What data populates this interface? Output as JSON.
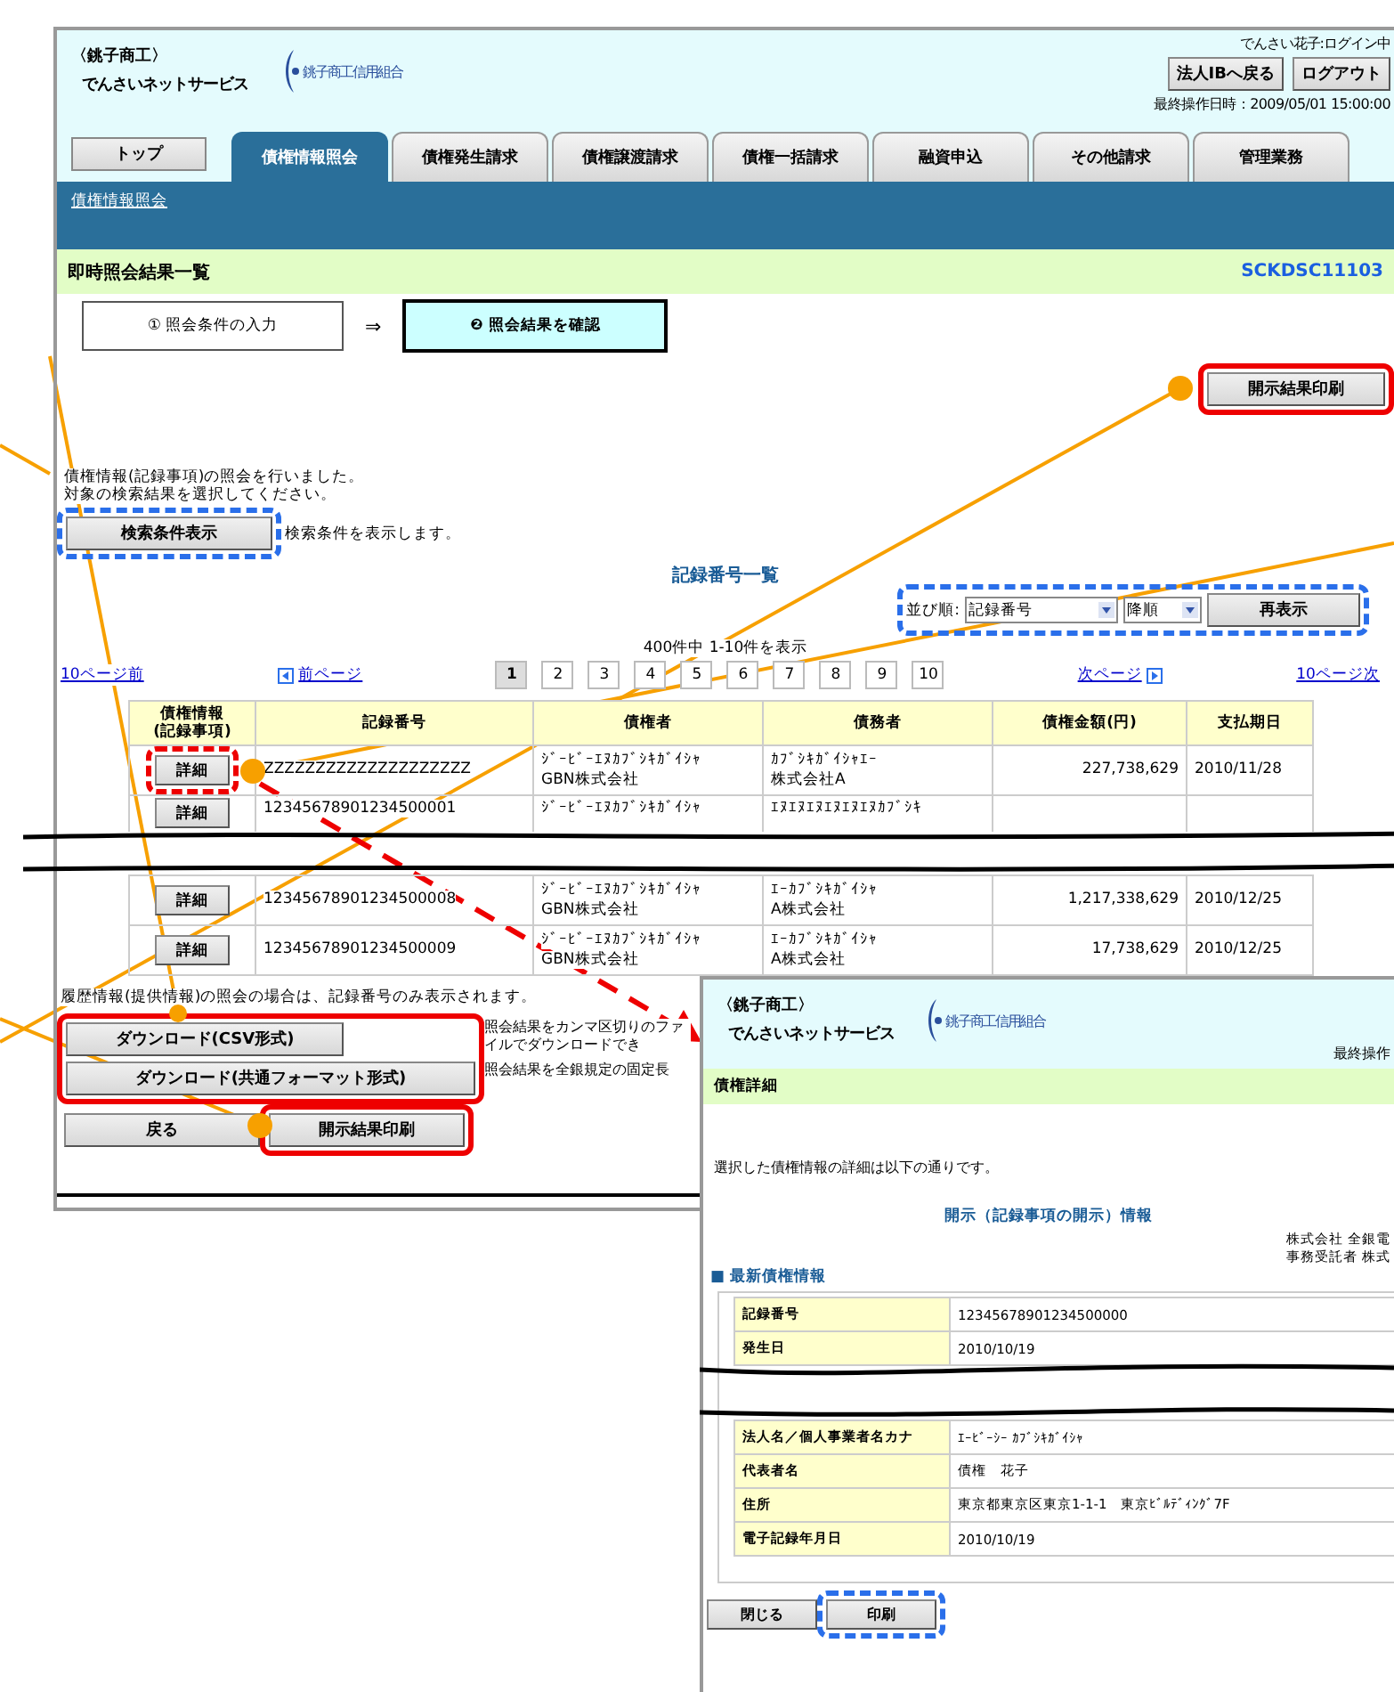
{
  "main_window": {
    "brand": {
      "line1": "〈銚子商工〉",
      "line2": "でんさいネットサービス",
      "logo_text": "銚子商工信用組合"
    },
    "user_status": "でんさい花子:ログイン中",
    "header_buttons": [
      "法人IBへ戻る",
      "ログアウト"
    ],
    "last_operation": "最終操作日時：2009/05/01 15:00:00",
    "tabs": [
      {
        "label": "トップ",
        "kind": "plain",
        "selected": false
      },
      {
        "label": "債権情報照会",
        "kind": "tab",
        "selected": true
      },
      {
        "label": "債権発生請求",
        "kind": "tab",
        "selected": false
      },
      {
        "label": "債権譲渡請求",
        "kind": "tab",
        "selected": false
      },
      {
        "label": "債権一括請求",
        "kind": "tab",
        "selected": false
      },
      {
        "label": "融資申込",
        "kind": "tab",
        "selected": false
      },
      {
        "label": "その他請求",
        "kind": "tab",
        "selected": false
      },
      {
        "label": "管理業務",
        "kind": "tab",
        "selected": false
      }
    ],
    "breadcrumb": "債権情報照会",
    "page_title": "即時照会結果一覧",
    "screen_id": "SCKDSC11103",
    "steps": [
      {
        "label": "① 照会条件の入力",
        "selected": false
      },
      {
        "label": "❷ 照会結果を確認",
        "selected": true
      }
    ],
    "step_arrow": "⇒",
    "top_print_button": {
      "label": "開示結果印刷",
      "highlight": {
        "kind": "red_solid"
      }
    },
    "message": [
      "債権情報(記録事項)の照会を行いました。",
      "対象の検索結果を選択してください。"
    ],
    "search_condition": {
      "button": "検索条件表示",
      "highlight": {
        "kind": "blue_dashed"
      },
      "hint": "検索条件を表示します。"
    },
    "list_title": "記録番号一覧",
    "sort": {
      "label": "並び順:",
      "field": "記録番号",
      "order": "降順",
      "button": "再表示",
      "highlight": {
        "kind": "blue_dashed"
      }
    },
    "result_count": "400件中 1-10件を表示",
    "pagination": {
      "prev10": "10ページ前",
      "prev": "前ページ",
      "pages": [
        {
          "label": "1",
          "selected": true
        },
        {
          "label": "2",
          "selected": false
        },
        {
          "label": "3",
          "selected": false
        },
        {
          "label": "4",
          "selected": false
        },
        {
          "label": "5",
          "selected": false
        },
        {
          "label": "6",
          "selected": false
        },
        {
          "label": "7",
          "selected": false
        },
        {
          "label": "8",
          "selected": false
        },
        {
          "label": "9",
          "selected": false
        },
        {
          "label": "10",
          "selected": false
        }
      ],
      "next": "次ページ",
      "next10": "10ページ次"
    },
    "table": {
      "columns": [
        "債権情報\n(記録事項)",
        "記録番号",
        "債権者",
        "債務者",
        "債権金額(円)",
        "支払期日"
      ],
      "rows": [
        {
          "kind": "row",
          "button": "詳細",
          "highlight": {
            "kind": "red_dashed"
          },
          "record_no": "ZZZZZZZZZZZZZZZZZZZZ",
          "creditor": [
            "ｼﾞｰﾋﾞｰｴﾇｶﾌﾞｼｷｶﾞｲｼｬ",
            "GBN株式会社"
          ],
          "debtor": [
            "ｶﾌﾞｼｷｶﾞｲｼｬｴｰ",
            "株式会社A"
          ],
          "amount": "227,738,629",
          "due": "2010/11/28"
        },
        {
          "kind": "row",
          "button": "詳細",
          "record_no": "12345678901234500001",
          "creditor": [
            "ｼﾞｰﾋﾞｰｴﾇｶﾌﾞｼｷｶﾞｲｼｬ"
          ],
          "debtor": [
            "ｴﾇｴﾇｴﾇｴﾇｴﾇｴﾇｶﾌﾞｼｷ"
          ]
        },
        {
          "kind": "break"
        },
        {
          "kind": "row",
          "button": "詳細",
          "record_no": "12345678901234500008",
          "creditor": [
            "ｼﾞｰﾋﾞｰｴﾇｶﾌﾞｼｷｶﾞｲｼｬ",
            "GBN株式会社"
          ],
          "debtor": [
            "ｴｰｶﾌﾞｼｷｶﾞｲｼｬ",
            "A株式会社"
          ],
          "amount": "1,217,338,629",
          "due": "2010/12/25"
        },
        {
          "kind": "row",
          "button": "詳細",
          "record_no": "12345678901234500009",
          "creditor": [
            "ｼﾞｰﾋﾞｰｴﾇｶﾌﾞｼｷｶﾞｲｼｬ",
            "GBN株式会社"
          ],
          "debtor": [
            "ｴｰｶﾌﾞｼｷｶﾞｲｼｬ",
            "A株式会社"
          ],
          "amount": "17,738,629",
          "due": "2010/12/25"
        }
      ]
    },
    "note": "履歴情報(提供情報)の照会の場合は、記録番号のみ表示されます。",
    "downloads": {
      "highlight": {
        "kind": "red_solid"
      },
      "items": [
        {
          "button": "ダウンロード(CSV形式)",
          "hint": "照会結果をカンマ区切りのファイルでダウンロードでき"
        },
        {
          "button": "ダウンロード(共通フォーマット形式)",
          "hint": "照会結果を全銀規定の固定長"
        }
      ]
    },
    "footer_buttons": [
      {
        "label": "戻る"
      },
      {
        "label": "開示結果印刷",
        "highlight": {
          "kind": "red_solid"
        }
      }
    ]
  },
  "detail_window": {
    "brand": {
      "line1": "〈銚子商工〉",
      "line2": "でんさいネットサービス",
      "logo_text": "銚子商工信用組合"
    },
    "last_operation": "最終操作",
    "page_title": "債権詳細",
    "message": "選択した債権情報の詳細は以下の通りです。",
    "section_title": "開示（記録事項の開示）情報",
    "issuer": [
      "株式会社 全銀電",
      "事務受託者 株式"
    ],
    "subsection": "■ 最新債権情報",
    "rows": [
      {
        "kind": "row",
        "label": "記録番号",
        "value": "12345678901234500000"
      },
      {
        "kind": "row",
        "label": "発生日",
        "value": "2010/10/19"
      },
      {
        "kind": "break"
      },
      {
        "kind": "row",
        "label": "法人名／個人事業者名カナ",
        "value": "ｴｰﾋﾞｰｼｰ ｶﾌﾞｼｷｶﾞｲｼｬ"
      },
      {
        "kind": "row",
        "label": "代表者名",
        "value": "債権　花子"
      },
      {
        "kind": "row",
        "label": "住所",
        "value": "東京都東京区東京1-1-1　東京ﾋﾞﾙﾃﾞｨﾝｸﾞ7F"
      },
      {
        "kind": "row",
        "label": "電子記録年月日",
        "value": "2010/10/19"
      }
    ],
    "buttons": [
      {
        "label": "閉じる"
      },
      {
        "label": "印刷",
        "highlight": {
          "kind": "blue_dashed"
        }
      }
    ]
  }
}
